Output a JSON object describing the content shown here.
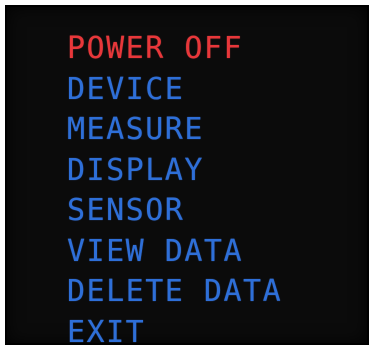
{
  "menu": {
    "active_color": "#e8373a",
    "item_color": "#2e6fd8",
    "items": [
      {
        "label": "POWER OFF",
        "active": true
      },
      {
        "label": "DEVICE",
        "active": false
      },
      {
        "label": "MEASURE",
        "active": false
      },
      {
        "label": "DISPLAY",
        "active": false
      },
      {
        "label": "SENSOR",
        "active": false
      },
      {
        "label": "VIEW DATA",
        "active": false
      },
      {
        "label": "DELETE DATA",
        "active": false
      },
      {
        "label": "EXIT",
        "active": false
      }
    ]
  }
}
